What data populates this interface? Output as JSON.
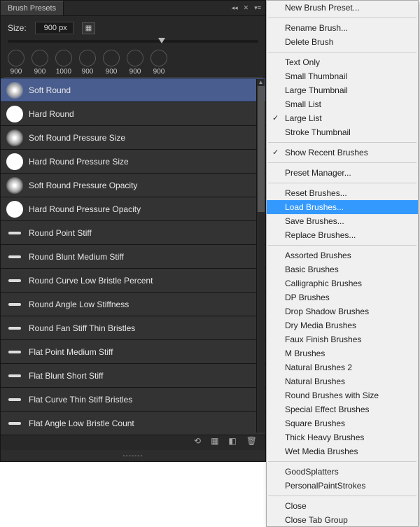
{
  "panel": {
    "tab": "Brush Presets",
    "size_label": "Size:",
    "size_value": "900 px"
  },
  "thumb_strip": [
    {
      "label": "900"
    },
    {
      "label": "900"
    },
    {
      "label": "1000"
    },
    {
      "label": "900"
    },
    {
      "label": "900"
    },
    {
      "label": "900"
    },
    {
      "label": "900"
    }
  ],
  "brushes": [
    {
      "label": "Soft Round",
      "style": "soft",
      "selected": true
    },
    {
      "label": "Hard Round",
      "style": "hard"
    },
    {
      "label": "Soft Round Pressure Size",
      "style": "soft"
    },
    {
      "label": "Hard Round Pressure Size",
      "style": "hard"
    },
    {
      "label": "Soft Round Pressure Opacity",
      "style": "soft"
    },
    {
      "label": "Hard Round Pressure Opacity",
      "style": "hard"
    },
    {
      "label": "Round Point Stiff",
      "style": "dash"
    },
    {
      "label": "Round Blunt Medium Stiff",
      "style": "dash"
    },
    {
      "label": "Round Curve Low Bristle Percent",
      "style": "dash"
    },
    {
      "label": "Round Angle Low Stiffness",
      "style": "dash"
    },
    {
      "label": "Round Fan Stiff Thin Bristles",
      "style": "dash"
    },
    {
      "label": "Flat Point Medium Stiff",
      "style": "dash"
    },
    {
      "label": "Flat Blunt Short Stiff",
      "style": "dash"
    },
    {
      "label": "Flat Curve Thin Stiff Bristles",
      "style": "dash"
    },
    {
      "label": "Flat Angle Low Bristle Count",
      "style": "dash"
    }
  ],
  "menu_groups": [
    [
      {
        "label": "New Brush Preset..."
      }
    ],
    [
      {
        "label": "Rename Brush..."
      },
      {
        "label": "Delete Brush"
      }
    ],
    [
      {
        "label": "Text Only"
      },
      {
        "label": "Small Thumbnail"
      },
      {
        "label": "Large Thumbnail"
      },
      {
        "label": "Small List"
      },
      {
        "label": "Large List",
        "checked": true
      },
      {
        "label": "Stroke Thumbnail"
      }
    ],
    [
      {
        "label": "Show Recent Brushes",
        "checked": true
      }
    ],
    [
      {
        "label": "Preset Manager..."
      }
    ],
    [
      {
        "label": "Reset Brushes..."
      },
      {
        "label": "Load Brushes...",
        "highlighted": true
      },
      {
        "label": "Save Brushes..."
      },
      {
        "label": "Replace Brushes..."
      }
    ],
    [
      {
        "label": "Assorted Brushes"
      },
      {
        "label": "Basic Brushes"
      },
      {
        "label": "Calligraphic Brushes"
      },
      {
        "label": "DP Brushes"
      },
      {
        "label": "Drop Shadow Brushes"
      },
      {
        "label": "Dry Media Brushes"
      },
      {
        "label": "Faux Finish Brushes"
      },
      {
        "label": "M Brushes"
      },
      {
        "label": "Natural Brushes 2"
      },
      {
        "label": "Natural Brushes"
      },
      {
        "label": "Round Brushes with Size"
      },
      {
        "label": "Special Effect Brushes"
      },
      {
        "label": "Square Brushes"
      },
      {
        "label": "Thick Heavy Brushes"
      },
      {
        "label": "Wet Media Brushes"
      }
    ],
    [
      {
        "label": "GoodSplatters"
      },
      {
        "label": "PersonalPaintStrokes"
      }
    ],
    [
      {
        "label": "Close"
      },
      {
        "label": "Close Tab Group"
      }
    ]
  ]
}
